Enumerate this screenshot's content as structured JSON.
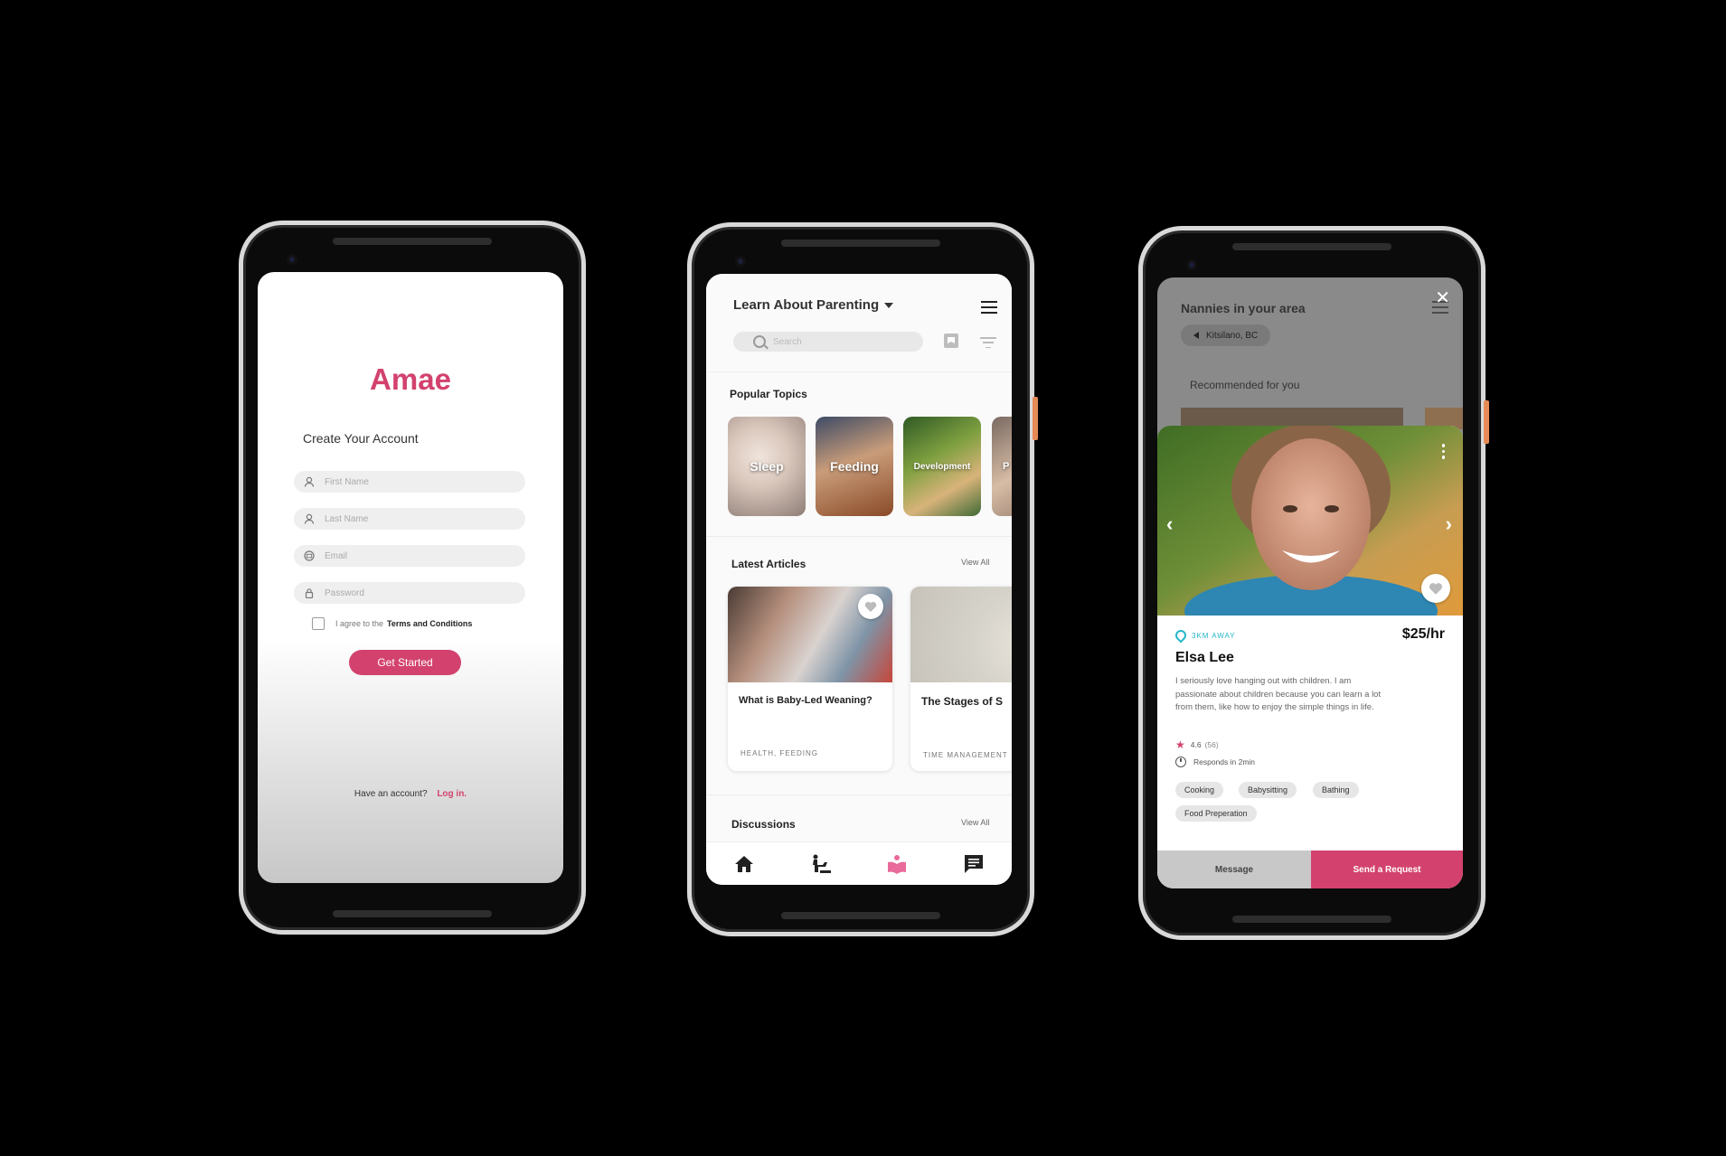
{
  "accent_color": "#d3426e",
  "signup": {
    "logo": "Amae",
    "title": "Create Your Account",
    "fields": [
      {
        "icon": "person-icon",
        "placeholder": "First Name"
      },
      {
        "icon": "person-icon",
        "placeholder": "Last Name"
      },
      {
        "icon": "email-icon",
        "placeholder": "Email"
      },
      {
        "icon": "lock-icon",
        "placeholder": "Password"
      }
    ],
    "agree_text": "I agree to the",
    "terms_link": "Terms and Conditions",
    "submit_label": "Get Started",
    "have_account": "Have an account?",
    "login_link": "Log in."
  },
  "learn": {
    "title": "Learn About Parenting",
    "search_placeholder": "Search",
    "popular_title": "Popular Topics",
    "topics": [
      "Sleep",
      "Feeding",
      "Development",
      "P"
    ],
    "latest_title": "Latest Articles",
    "view_all": "View All",
    "articles": [
      {
        "title": "What is Baby-Led Weaning?",
        "tags": "HEALTH, FEEDING"
      },
      {
        "title": "The Stages of S",
        "tags": "TIME MANAGEMENT"
      }
    ],
    "discussions_title": "Discussions",
    "nav": [
      "home-icon",
      "baby-changing-icon",
      "learn-book-icon",
      "chat-icon"
    ]
  },
  "nanny": {
    "title": "Nannies in your area",
    "location": "Kitsilano, BC",
    "recommended": "Recommended for you",
    "distance": "3KM AWAY",
    "rate": "$25/hr",
    "name": "Elsa Lee",
    "bio": "I seriously love hanging out with children. I am passionate about children because you can learn a lot from them, like how to enjoy the simple things in life.",
    "rating": "4.6",
    "rating_count": "(56)",
    "response": "Responds in 2min",
    "skills": [
      "Cooking",
      "Babysitting",
      "Bathing",
      "Food Preperation"
    ],
    "message_label": "Message",
    "request_label": "Send a Request"
  }
}
